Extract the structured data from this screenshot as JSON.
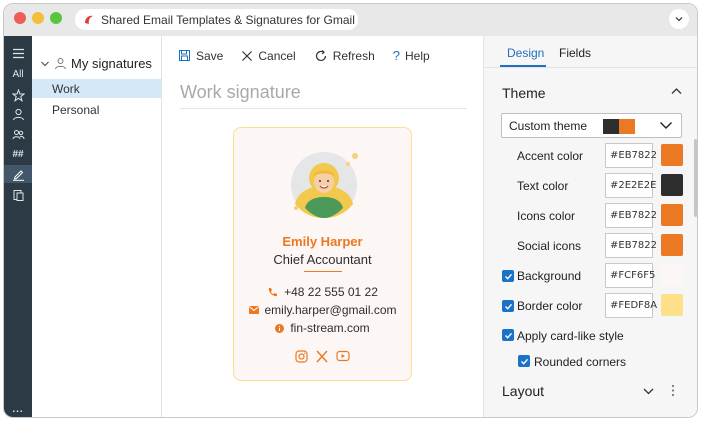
{
  "window": {
    "title": "Shared Email Templates & Signatures for Gmail"
  },
  "rail": {
    "all_label": "All",
    "more_label": "...",
    "hash_label": "##"
  },
  "folders": {
    "header": "My signatures",
    "items": [
      {
        "label": "Work",
        "active": true
      },
      {
        "label": "Personal",
        "active": false
      }
    ]
  },
  "toolbar": {
    "save": "Save",
    "cancel": "Cancel",
    "refresh": "Refresh",
    "help": "Help"
  },
  "editor": {
    "signature_title": "Work signature"
  },
  "card": {
    "name": "Emily Harper",
    "job_title": "Chief Accountant",
    "phone": "+48 22 555 01 22",
    "email": "emily.harper@gmail.com",
    "website": "fin-stream.com",
    "socials": [
      "instagram-icon",
      "x-icon",
      "youtube-icon"
    ]
  },
  "panel": {
    "tabs": [
      {
        "label": "Design",
        "active": true
      },
      {
        "label": "Fields",
        "active": false
      }
    ],
    "theme_section": "Theme",
    "theme_select": "Custom theme",
    "theme_colors": [
      "#2E2E2E",
      "#EB7822"
    ],
    "colors": [
      {
        "label": "Accent color",
        "hex": "#EB7822",
        "swatch": "#EB7822",
        "checkbox": false
      },
      {
        "label": "Text color",
        "hex": "#2E2E2E",
        "swatch": "#2E2E2E",
        "checkbox": false
      },
      {
        "label": "Icons color",
        "hex": "#EB7822",
        "swatch": "#EB7822",
        "checkbox": false
      },
      {
        "label": "Social icons",
        "hex": "#EB7822",
        "swatch": "#EB7822",
        "checkbox": false
      },
      {
        "label": "Background",
        "hex": "#FCF6F5",
        "swatch": "#FCF6F5",
        "checkbox": true
      },
      {
        "label": "Border color",
        "hex": "#FEDF8A",
        "swatch": "#FEDF8A",
        "checkbox": true
      }
    ],
    "card_style_label": "Apply card-like style",
    "rounded_label": "Rounded corners",
    "layout_section": "Layout"
  }
}
